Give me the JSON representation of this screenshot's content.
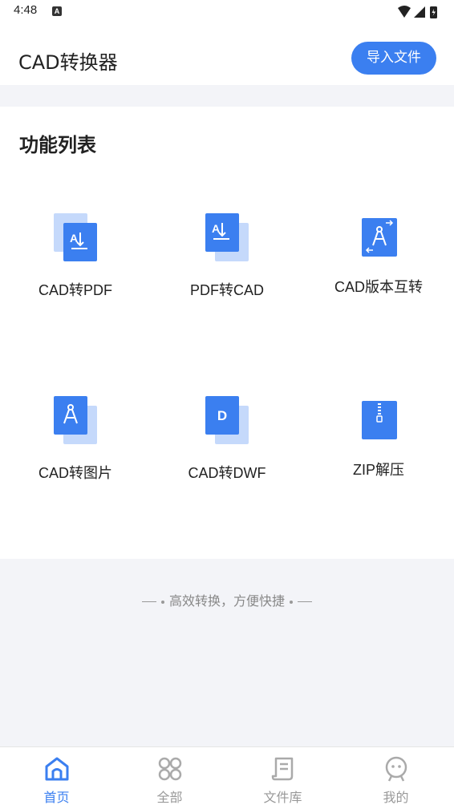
{
  "status_bar": {
    "time": "4:48",
    "notification_badge": "A"
  },
  "header": {
    "title": "CAD转换器",
    "import_button": "导入文件"
  },
  "functions": {
    "title": "功能列表",
    "items": [
      {
        "label": "CAD转PDF",
        "icon": "cad-to-pdf-icon"
      },
      {
        "label": "PDF转CAD",
        "icon": "pdf-to-cad-icon"
      },
      {
        "label": "CAD版本互转",
        "icon": "cad-version-convert-icon"
      },
      {
        "label": "CAD转图片",
        "icon": "cad-to-image-icon"
      },
      {
        "label": "CAD转DWF",
        "icon": "cad-to-dwf-icon"
      },
      {
        "label": "ZIP解压",
        "icon": "zip-extract-icon"
      }
    ]
  },
  "slogan": "高效转换，方便快捷",
  "bottom_nav": {
    "items": [
      {
        "label": "首页",
        "icon": "home-icon",
        "active": true
      },
      {
        "label": "全部",
        "icon": "grid-icon",
        "active": false
      },
      {
        "label": "文件库",
        "icon": "file-library-icon",
        "active": false
      },
      {
        "label": "我的",
        "icon": "profile-icon",
        "active": false
      }
    ]
  },
  "colors": {
    "accent": "#3b7ff0",
    "accent_light": "#c5d9fb",
    "background": "#f3f4f8"
  }
}
